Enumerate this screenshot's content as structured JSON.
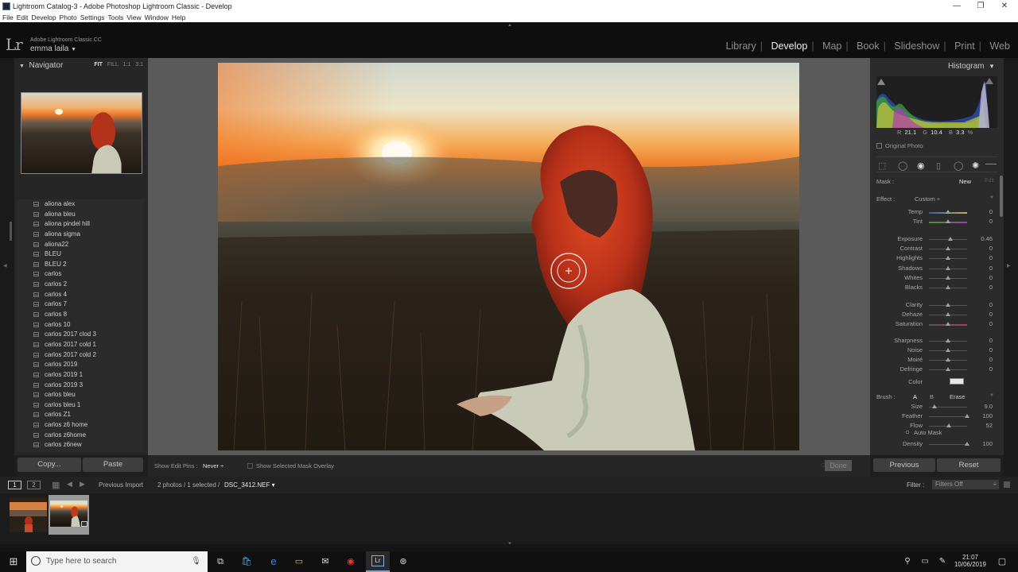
{
  "window": {
    "title": "Lightroom Catalog-3 - Adobe Photoshop Lightroom Classic - Develop",
    "minimize": "—",
    "maximize": "❐",
    "close": "✕"
  },
  "menu": [
    "File",
    "Edit",
    "Develop",
    "Photo",
    "Settings",
    "Tools",
    "View",
    "Window",
    "Help"
  ],
  "identity": {
    "logo": "Lr",
    "app_name": "Adobe Lightroom Classic CC",
    "user": "emma laila",
    "user_caret": "▼"
  },
  "modules": [
    {
      "label": "Library",
      "active": false
    },
    {
      "label": "Develop",
      "active": true
    },
    {
      "label": "Map",
      "active": false
    },
    {
      "label": "Book",
      "active": false
    },
    {
      "label": "Slideshow",
      "active": false
    },
    {
      "label": "Print",
      "active": false
    },
    {
      "label": "Web",
      "active": false
    }
  ],
  "navigator": {
    "title": "Navigator",
    "zoom_fit": "FIT",
    "zoom_fill": "FILL",
    "zoom_1_1": "1:1",
    "zoom_3_1": "3:1"
  },
  "presets": [
    "aliona alex",
    "aliona bleu",
    "aliona pindel hill",
    "aliona sigma",
    "aliona22",
    "BLEU",
    "BLEU 2",
    "carlos",
    "carlos 2",
    "carlos 4",
    "carlos 7",
    "carlos 8",
    "carlos 10",
    "carlos 2017 clod 3",
    "carlos 2017 cold 1",
    "carlos 2017 cold 2",
    "carlos 2019",
    "carlos 2019 1",
    "carlos 2019 3",
    "carlos bleu",
    "carlos bleu 1",
    "carlos Z1",
    "carlos z6 home",
    "carlos z6home",
    "carlos z6new"
  ],
  "left_buttons": {
    "copy": "Copy...",
    "paste": "Paste"
  },
  "toolbar": {
    "show_edit_pins_label": "Show Edit Pins :",
    "show_edit_pins_value": "Never",
    "show_mask_overlay": "Show Selected Mask Overlay",
    "done": "Done"
  },
  "histogram": {
    "title": "Histogram",
    "r_label": "R",
    "r_value": "21.1",
    "g_label": "G",
    "g_value": "10.4",
    "b_label": "B",
    "b_value": "3.3",
    "percent": "%",
    "original_photo": "Original Photo"
  },
  "mask": {
    "label": "Mask :",
    "new": "New",
    "edit": "Edit"
  },
  "effect": {
    "label": "Effect :",
    "value": "Custom ÷"
  },
  "sliders": {
    "temp": {
      "label": "Temp",
      "value": "0",
      "pos": 0.5
    },
    "tint": {
      "label": "Tint",
      "value": "0",
      "pos": 0.5
    },
    "exposure": {
      "label": "Exposure",
      "value": "0.46",
      "pos": 0.56
    },
    "contrast": {
      "label": "Contrast",
      "value": "0",
      "pos": 0.5
    },
    "highlights": {
      "label": "Highlights",
      "value": "0",
      "pos": 0.5
    },
    "shadows": {
      "label": "Shadows",
      "value": "0",
      "pos": 0.5
    },
    "whites": {
      "label": "Whites",
      "value": "0",
      "pos": 0.5
    },
    "blacks": {
      "label": "Blacks",
      "value": "0",
      "pos": 0.5
    },
    "clarity": {
      "label": "Clarity",
      "value": "0",
      "pos": 0.5
    },
    "dehaze": {
      "label": "Dehaze",
      "value": "0",
      "pos": 0.5
    },
    "saturation": {
      "label": "Saturation",
      "value": "0",
      "pos": 0.5
    },
    "sharpness": {
      "label": "Sharpness",
      "value": "0",
      "pos": 0.5
    },
    "noise": {
      "label": "Noise",
      "value": "0",
      "pos": 0.5
    },
    "moire": {
      "label": "Moiré",
      "value": "0",
      "pos": 0.5
    },
    "defringe": {
      "label": "Defringe",
      "value": "0",
      "pos": 0.5
    }
  },
  "color": {
    "label": "Color"
  },
  "brush": {
    "label": "Brush :",
    "a": "A",
    "b": "B",
    "erase": "Erase",
    "size": {
      "label": "Size",
      "value": "9.0",
      "pos": 0.15
    },
    "feather": {
      "label": "Feather",
      "value": "100",
      "pos": 1.0
    },
    "flow": {
      "label": "Flow",
      "value": "52",
      "pos": 0.52
    },
    "auto_mask": "Auto Mask",
    "density": {
      "label": "Density",
      "value": "100",
      "pos": 1.0
    }
  },
  "right_buttons": {
    "previous": "Previous",
    "reset": "Reset"
  },
  "filmstrip": {
    "page1": "1",
    "page2": "2",
    "source": "Previous Import",
    "selection": "2 photos / 1 selected /",
    "filename": "DSC_3412.NEF",
    "filename_caret": "▾",
    "filter_label": "Filter :",
    "filter_value": "Filters Off"
  },
  "taskbar": {
    "search_placeholder": "Type here to search",
    "time": "21:07",
    "date": "10/06/2019"
  },
  "colors": {
    "accent_bg": "#262626",
    "hair": "#c23a1c",
    "sunset": "#f28a2e"
  }
}
